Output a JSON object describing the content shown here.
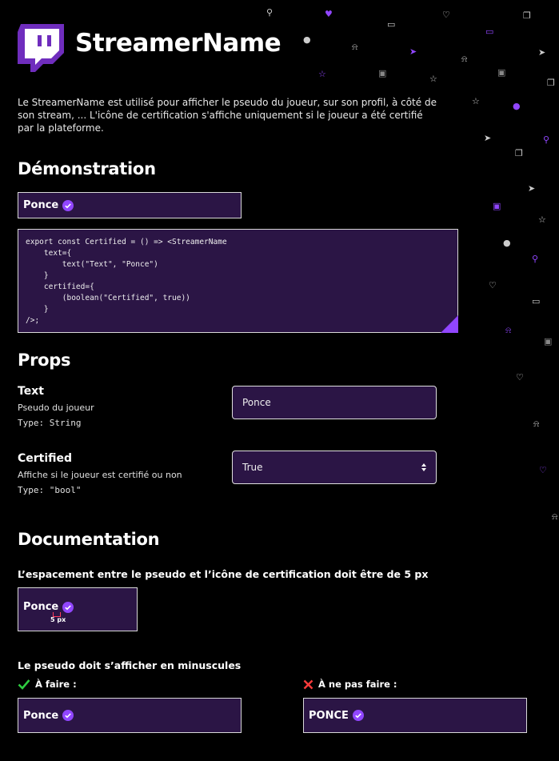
{
  "header": {
    "title": "StreamerName",
    "intro": "Le StreamerName est utilisé pour afficher le pseudo du joueur, sur son profil, à côté de son stream, ... L'icône de certification s'affiche uniquement si le joueur a été certifié par la plateforme."
  },
  "demo": {
    "heading": "Démonstration",
    "sample_name": "Ponce",
    "code": "export const Certified = () => <StreamerName\n    text={\n        text(\"Text\", \"Ponce\")\n    }\n    certified={\n        (boolean(\"Certified\", true))\n    }\n/>;"
  },
  "props": {
    "heading": "Props",
    "text": {
      "name": "Text",
      "description": "Pseudo du joueur",
      "type": "Type: String",
      "value": "Ponce"
    },
    "certified": {
      "name": "Certified",
      "description": "Affiche si le joueur est certifié ou non",
      "type": "Type: \"bool\"",
      "selected": "True"
    }
  },
  "documentation": {
    "heading": "Documentation",
    "spacing_rule": "L’espacement entre le pseudo et l’icône de certification doit être de 5 px",
    "spacing_example_name": "Ponce",
    "spacing_label": "5 px",
    "case_rule": "Le pseudo doit s’afficher en minuscules",
    "do_label": "À faire :",
    "dont_label": "À ne pas faire :",
    "do_example": "Ponce",
    "dont_example": "PONCE"
  },
  "colors": {
    "background": "#000000",
    "panel": "#2b1545",
    "accent": "#9146ff",
    "do_check": "#2ecc40",
    "dont_cross": "#ff3b3b"
  },
  "icons": [
    "twitch-logo-icon",
    "verified-badge-icon",
    "check-icon",
    "cross-icon",
    "dropdown-caret-icon"
  ]
}
